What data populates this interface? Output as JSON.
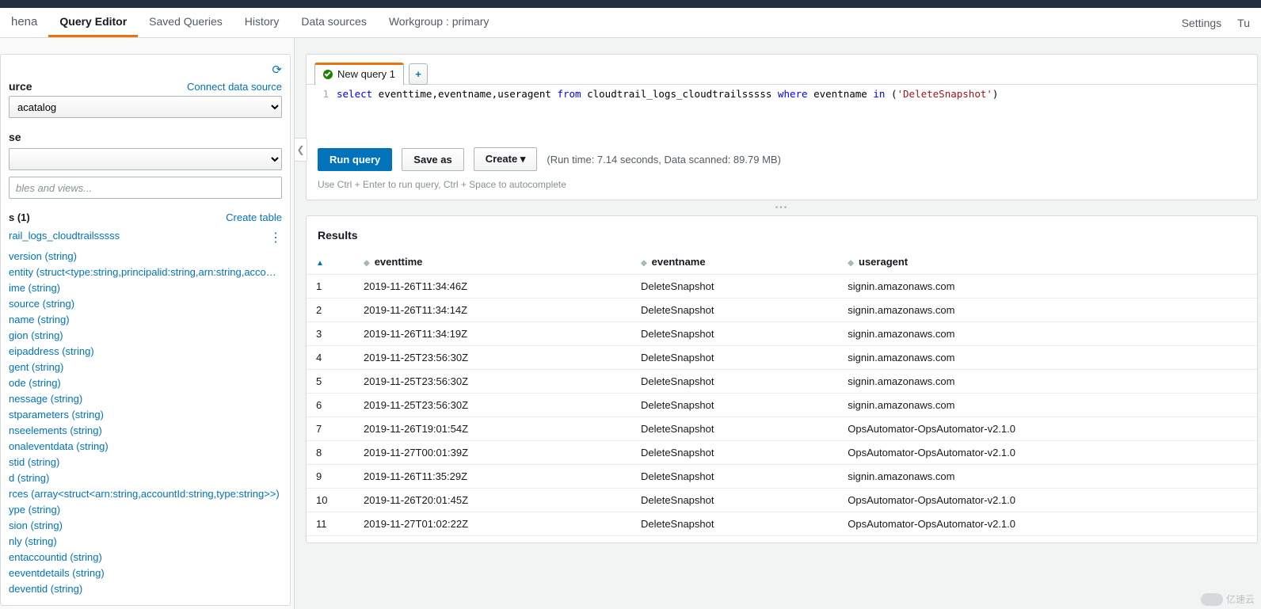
{
  "brand": "hena",
  "nav": {
    "tabs": [
      "Query Editor",
      "Saved Queries",
      "History",
      "Data sources",
      "Workgroup : primary"
    ],
    "right": [
      "Settings",
      "Tu"
    ]
  },
  "sidebar": {
    "data_source_label": "urce",
    "connect_link": "Connect data source",
    "data_source_value": "acatalog",
    "database_label": "se",
    "database_value": "",
    "filter_placeholder": "bles and views...",
    "tables_header": "s (1)",
    "create_table": "Create table",
    "table_name": "rail_logs_cloudtrailsssss",
    "columns": [
      "version (string)",
      "entity (struct<type:string,principalid:string,arn:string,accountI",
      "ime (string)",
      "source (string)",
      "name (string)",
      "gion (string)",
      "eipaddress (string)",
      "gent (string)",
      "ode (string)",
      "nessage (string)",
      "stparameters (string)",
      "nseelements (string)",
      "onaleventdata (string)",
      "stid (string)",
      "d (string)",
      "rces (array<struct<arn:string,accountId:string,type:string>>)",
      "ype (string)",
      "sion (string)",
      "nly (string)",
      "entaccountid (string)",
      "eeventdetails (string)",
      "deventid (string)"
    ]
  },
  "editor": {
    "tab_label": "New query 1",
    "query_parts": {
      "p1": "select",
      "p2": " eventtime,eventname,useragent ",
      "p3": "from",
      "p4": " cloudtrail_logs_cloudtrailsssss ",
      "p5": "where",
      "p6": " eventname ",
      "p7": "in",
      "p8": " (",
      "p9": "'DeleteSnapshot'",
      "p10": ")"
    },
    "run_label": "Run query",
    "save_label": "Save as",
    "create_label": "Create",
    "run_info": "(Run time: 7.14 seconds, Data scanned: 89.79 MB)",
    "hint": "Use Ctrl + Enter to run query, Ctrl + Space to autocomplete"
  },
  "results": {
    "title": "Results",
    "columns": [
      "eventtime",
      "eventname",
      "useragent"
    ],
    "rows": [
      {
        "n": "1",
        "eventtime": "2019-11-26T11:34:46Z",
        "eventname": "DeleteSnapshot",
        "useragent": "signin.amazonaws.com"
      },
      {
        "n": "2",
        "eventtime": "2019-11-26T11:34:14Z",
        "eventname": "DeleteSnapshot",
        "useragent": "signin.amazonaws.com"
      },
      {
        "n": "3",
        "eventtime": "2019-11-26T11:34:19Z",
        "eventname": "DeleteSnapshot",
        "useragent": "signin.amazonaws.com"
      },
      {
        "n": "4",
        "eventtime": "2019-11-25T23:56:30Z",
        "eventname": "DeleteSnapshot",
        "useragent": "signin.amazonaws.com"
      },
      {
        "n": "5",
        "eventtime": "2019-11-25T23:56:30Z",
        "eventname": "DeleteSnapshot",
        "useragent": "signin.amazonaws.com"
      },
      {
        "n": "6",
        "eventtime": "2019-11-25T23:56:30Z",
        "eventname": "DeleteSnapshot",
        "useragent": "signin.amazonaws.com"
      },
      {
        "n": "7",
        "eventtime": "2019-11-26T19:01:54Z",
        "eventname": "DeleteSnapshot",
        "useragent": "OpsAutomator-OpsAutomator-v2.1.0"
      },
      {
        "n": "8",
        "eventtime": "2019-11-27T00:01:39Z",
        "eventname": "DeleteSnapshot",
        "useragent": "OpsAutomator-OpsAutomator-v2.1.0"
      },
      {
        "n": "9",
        "eventtime": "2019-11-26T11:35:29Z",
        "eventname": "DeleteSnapshot",
        "useragent": "signin.amazonaws.com"
      },
      {
        "n": "10",
        "eventtime": "2019-11-26T20:01:45Z",
        "eventname": "DeleteSnapshot",
        "useragent": "OpsAutomator-OpsAutomator-v2.1.0"
      },
      {
        "n": "11",
        "eventtime": "2019-11-27T01:02:22Z",
        "eventname": "DeleteSnapshot",
        "useragent": "OpsAutomator-OpsAutomator-v2.1.0"
      }
    ]
  },
  "watermark": "亿速云"
}
